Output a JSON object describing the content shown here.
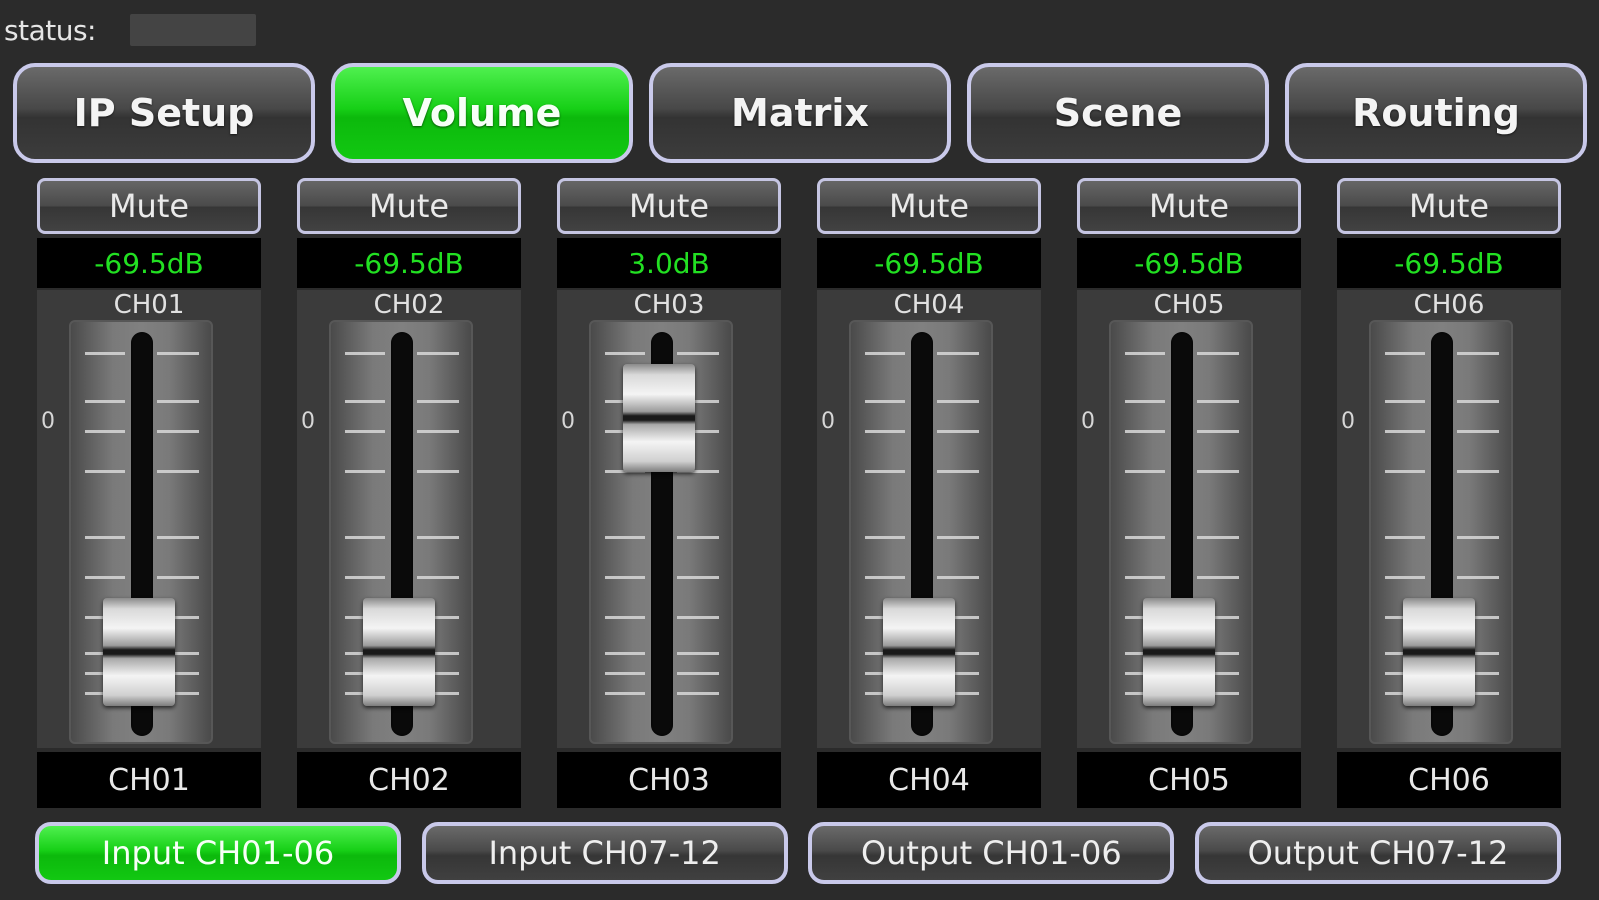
{
  "status": {
    "label": "status:",
    "value": ""
  },
  "main_tabs": [
    {
      "label": "IP Setup",
      "active": false
    },
    {
      "label": "Volume",
      "active": true
    },
    {
      "label": "Matrix",
      "active": false
    },
    {
      "label": "Scene",
      "active": false
    },
    {
      "label": "Routing",
      "active": false
    }
  ],
  "channels": [
    {
      "mute_label": "Mute",
      "db": "-69.5dB",
      "top_label": "CH01",
      "zero_mark": "0",
      "name": "CH01",
      "fader_level": 0.0
    },
    {
      "mute_label": "Mute",
      "db": "-69.5dB",
      "top_label": "CH02",
      "zero_mark": "0",
      "name": "CH02",
      "fader_level": 0.0
    },
    {
      "mute_label": "Mute",
      "db": "3.0dB",
      "top_label": "CH03",
      "zero_mark": "0",
      "name": "CH03",
      "fader_level": 0.86
    },
    {
      "mute_label": "Mute",
      "db": "-69.5dB",
      "top_label": "CH04",
      "zero_mark": "0",
      "name": "CH04",
      "fader_level": 0.0
    },
    {
      "mute_label": "Mute",
      "db": "-69.5dB",
      "top_label": "CH05",
      "zero_mark": "0",
      "name": "CH05",
      "fader_level": 0.0
    },
    {
      "mute_label": "Mute",
      "db": "-69.5dB",
      "top_label": "CH06",
      "zero_mark": "0",
      "name": "CH06",
      "fader_level": 0.0
    }
  ],
  "bottom_tabs": [
    {
      "label": "Input CH01-06",
      "active": true
    },
    {
      "label": "Input CH07-12",
      "active": false
    },
    {
      "label": "Output CH01-06",
      "active": false
    },
    {
      "label": "Output CH07-12",
      "active": false
    }
  ],
  "colors": {
    "active_green": "#17d017",
    "db_text": "#22e022",
    "border": "#c9c9ea",
    "background": "#2b2b2b"
  }
}
